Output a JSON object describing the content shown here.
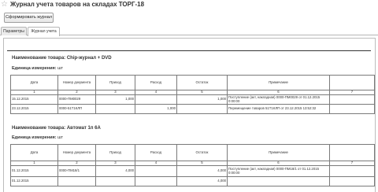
{
  "window": {
    "title": "Журнал учета товаров на складах ТОРГ-18",
    "form_button": "Сформировать журнал"
  },
  "tabs": [
    {
      "label": "Параметры",
      "active": false
    },
    {
      "label": "Журнал учета",
      "active": true
    }
  ],
  "columns": {
    "headers": [
      "Дата",
      "Номер документа",
      "Приход",
      "Расход",
      "Остаток",
      "Примечание"
    ],
    "numbers": [
      "1",
      "2",
      "3",
      "4",
      "5",
      "6",
      "7"
    ]
  },
  "sections": [
    {
      "title": "Наименование товара: Chip-журнал + DVD",
      "unit_label": "Единица измерения:",
      "unit_value": "шт",
      "rows": [
        {
          "date": "15.12.2015",
          "doc": "0000-ПМ0029",
          "in": "1,000",
          "out": "",
          "balance": "1,000",
          "note": "Поступление (акт, накладная) 0000-ПМ0029 от 01.12.2015 0:00:00"
        },
        {
          "date": "23.12.2015",
          "doc": "0000-51Т1КЛП",
          "in": "",
          "out": "1,000",
          "balance": "",
          "note": "Перемещение товаров 51Т1КЛП от 23.12.2015 13:52:32"
        }
      ]
    },
    {
      "title": "Наименование товара: Автомат 1п 6А",
      "unit_label": "Единица измерения:",
      "unit_value": "шт",
      "rows": [
        {
          "date": "01.12.2015",
          "doc": "0000-ПМ18/1",
          "in": "4,000",
          "out": "",
          "balance": "4,000",
          "note": "Поступление (акт, накладная) 0000-ПМ18/1 от 01.12.2015 0:00:00"
        },
        {
          "date": "01.12.2015",
          "doc": "",
          "in": "",
          "out": "",
          "balance": "4,000",
          "note": ""
        }
      ]
    }
  ]
}
